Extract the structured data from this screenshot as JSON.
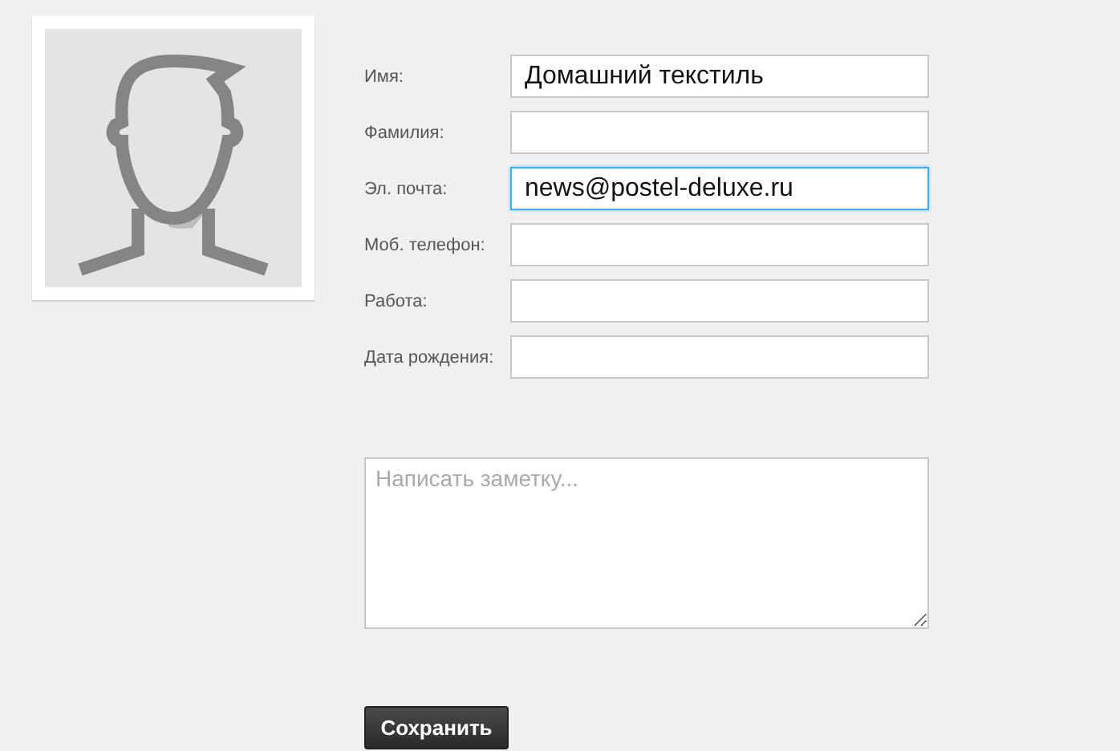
{
  "fields": [
    {
      "label": "Имя:",
      "value": "Домашний текстиль",
      "focused": false
    },
    {
      "label": "Фамилия:",
      "focused": false
    },
    {
      "label": "Эл. почта:",
      "value": "news@postel-deluxe.ru",
      "focused": true
    },
    {
      "label": "Моб. телефон:",
      "focused": false
    },
    {
      "label": "Работа:",
      "focused": false
    },
    {
      "label": "Дата рождения:",
      "focused": false
    }
  ],
  "note": {
    "placeholder": "Написать заметку..."
  },
  "save_button": "Сохранить"
}
